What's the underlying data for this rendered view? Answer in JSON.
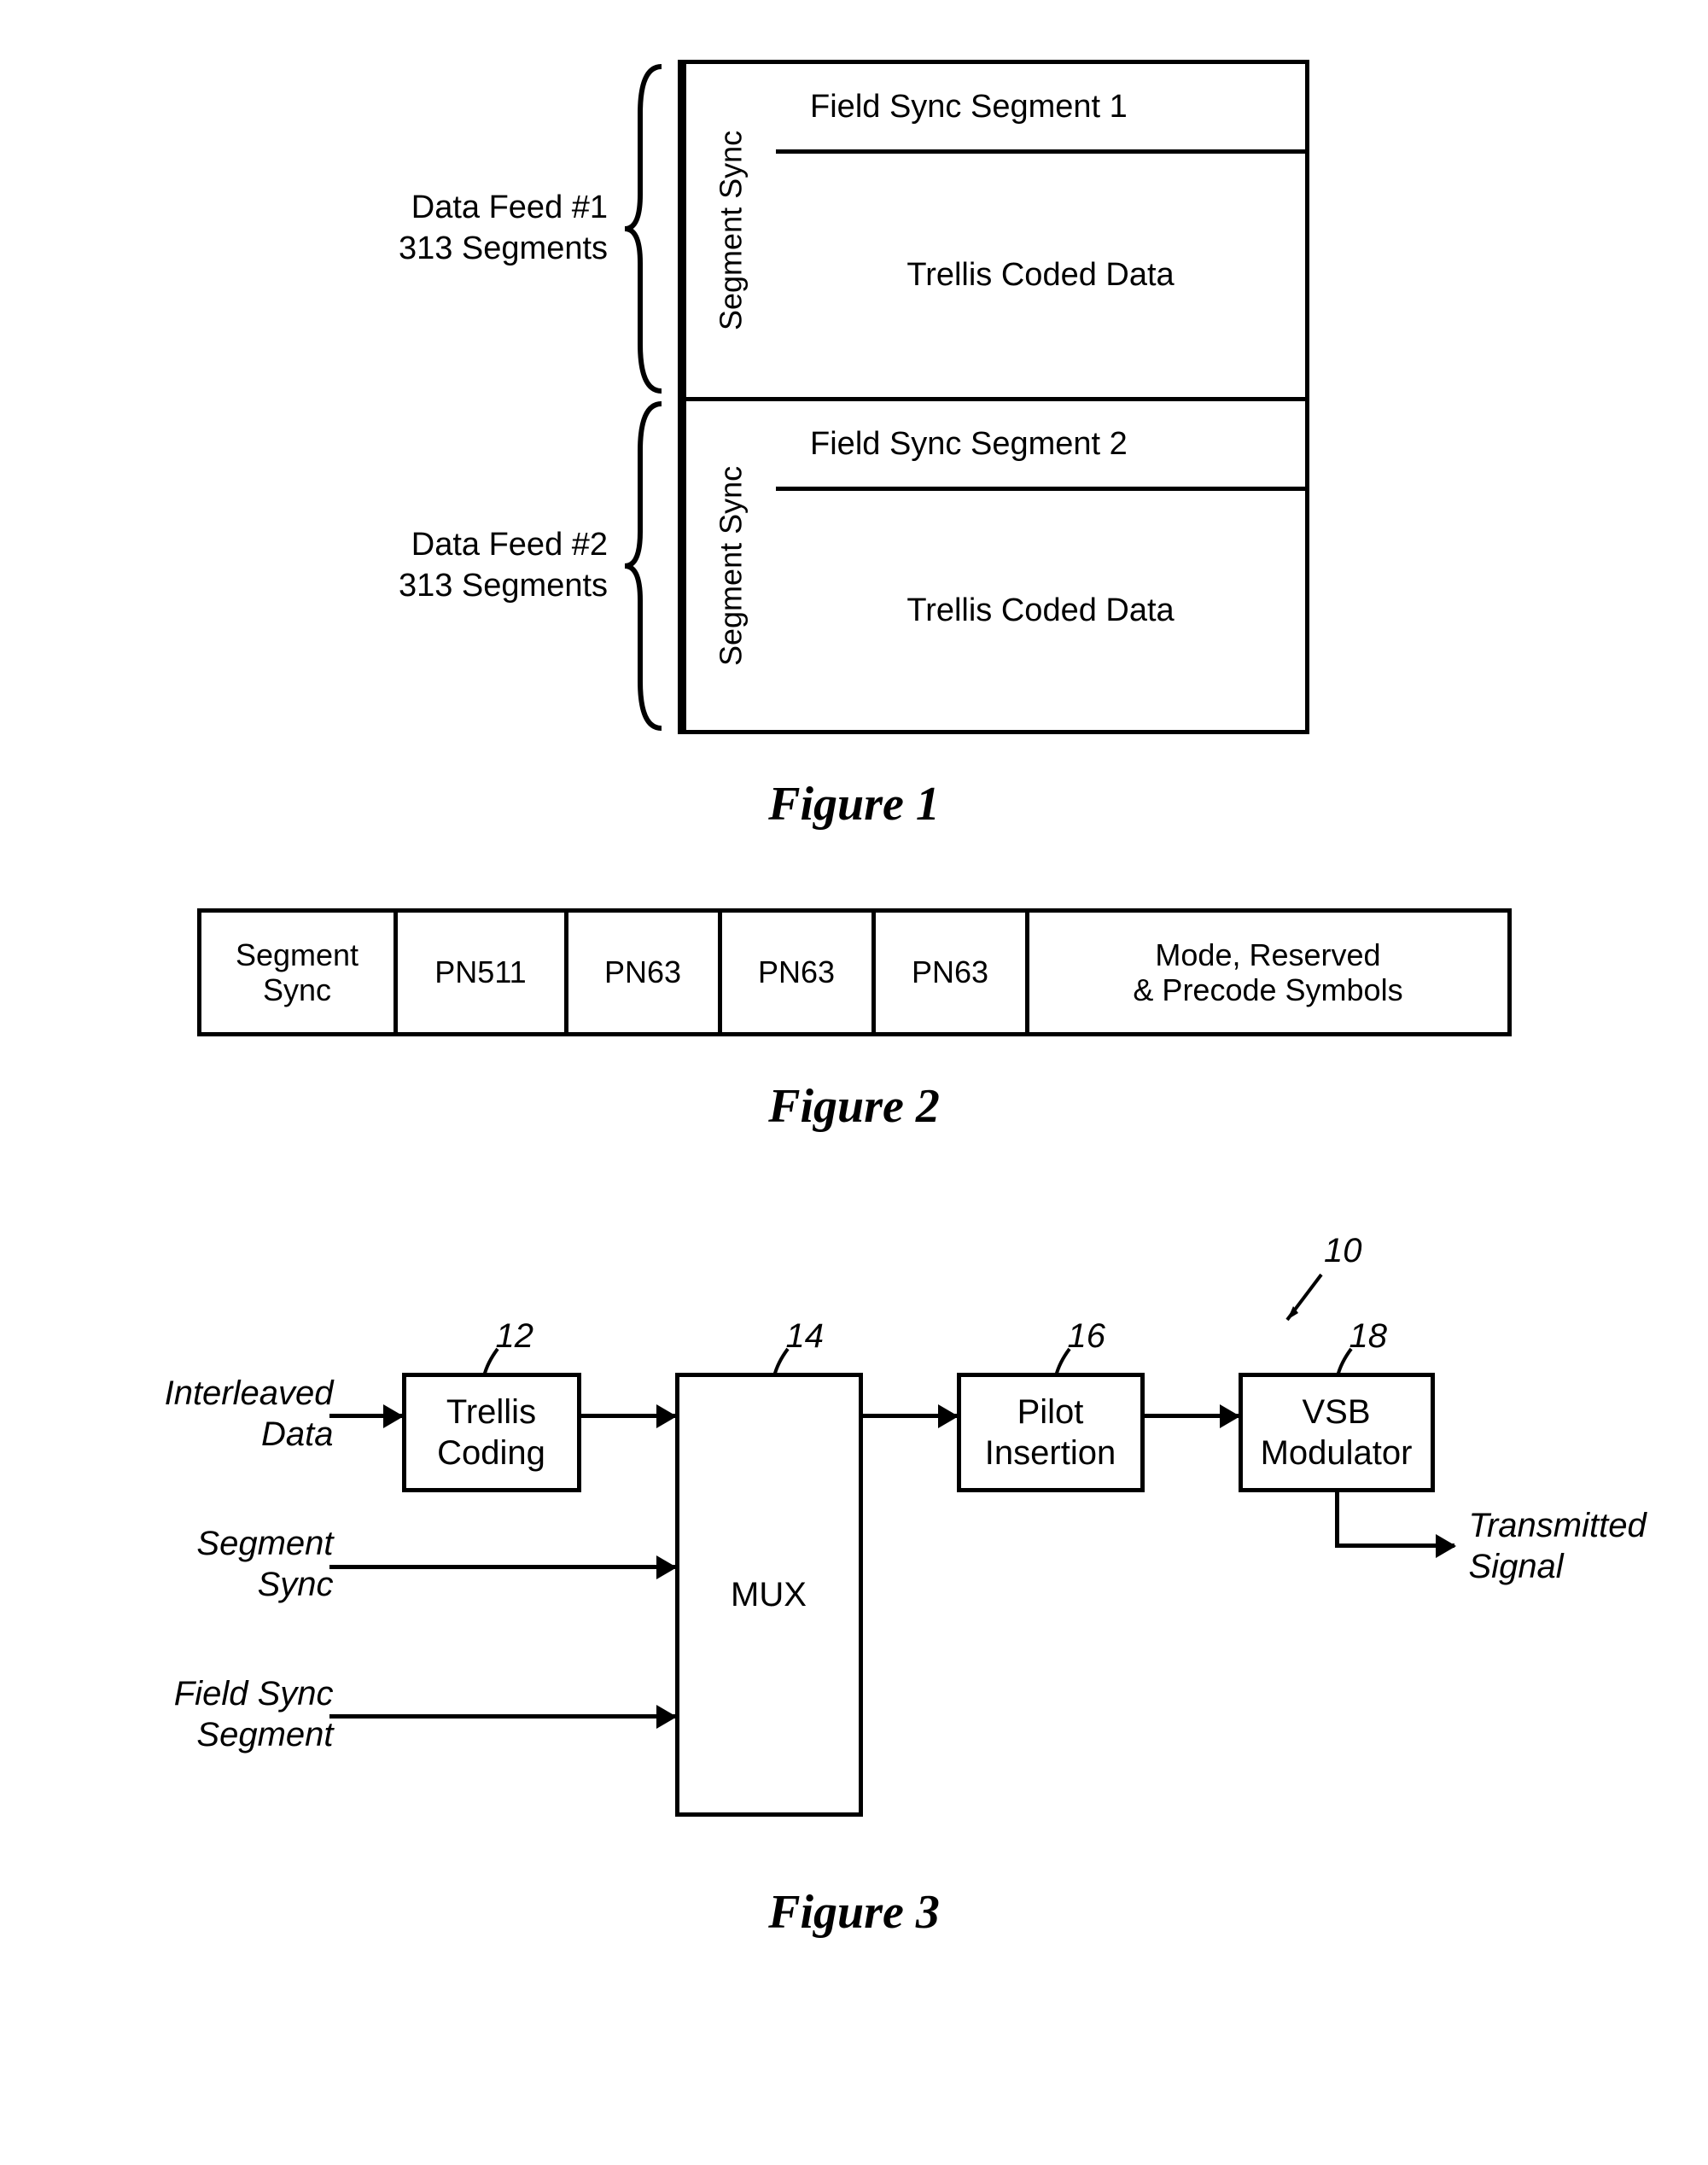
{
  "fig1": {
    "label1_line1": "Data Feed #1",
    "label1_line2": "313 Segments",
    "label2_line1": "Data Feed #2",
    "label2_line2": "313 Segments",
    "segment_sync": "Segment Sync",
    "field_sync_1": "Field Sync Segment 1",
    "field_sync_2": "Field Sync Segment 2",
    "trellis": "Trellis Coded Data",
    "caption": "Figure 1"
  },
  "fig2": {
    "cells": {
      "c0_l1": "Segment",
      "c0_l2": "Sync",
      "c1": "PN511",
      "c2": "PN63",
      "c3": "PN63",
      "c4": "PN63",
      "c5_l1": "Mode, Reserved",
      "c5_l2": "& Precode Symbols"
    },
    "caption": "Figure 2"
  },
  "fig3": {
    "inputs": {
      "interleaved_l1": "Interleaved",
      "interleaved_l2": "Data",
      "segment_l1": "Segment",
      "segment_l2": "Sync",
      "field_l1": "Field Sync",
      "field_l2": "Segment"
    },
    "boxes": {
      "trellis_l1": "Trellis",
      "trellis_l2": "Coding",
      "mux": "MUX",
      "pilot_l1": "Pilot",
      "pilot_l2": "Insertion",
      "vsb_l1": "VSB",
      "vsb_l2": "Modulator"
    },
    "refs": {
      "r10": "10",
      "r12": "12",
      "r14": "14",
      "r16": "16",
      "r18": "18"
    },
    "output_l1": "Transmitted",
    "output_l2": "Signal",
    "caption": "Figure 3"
  }
}
